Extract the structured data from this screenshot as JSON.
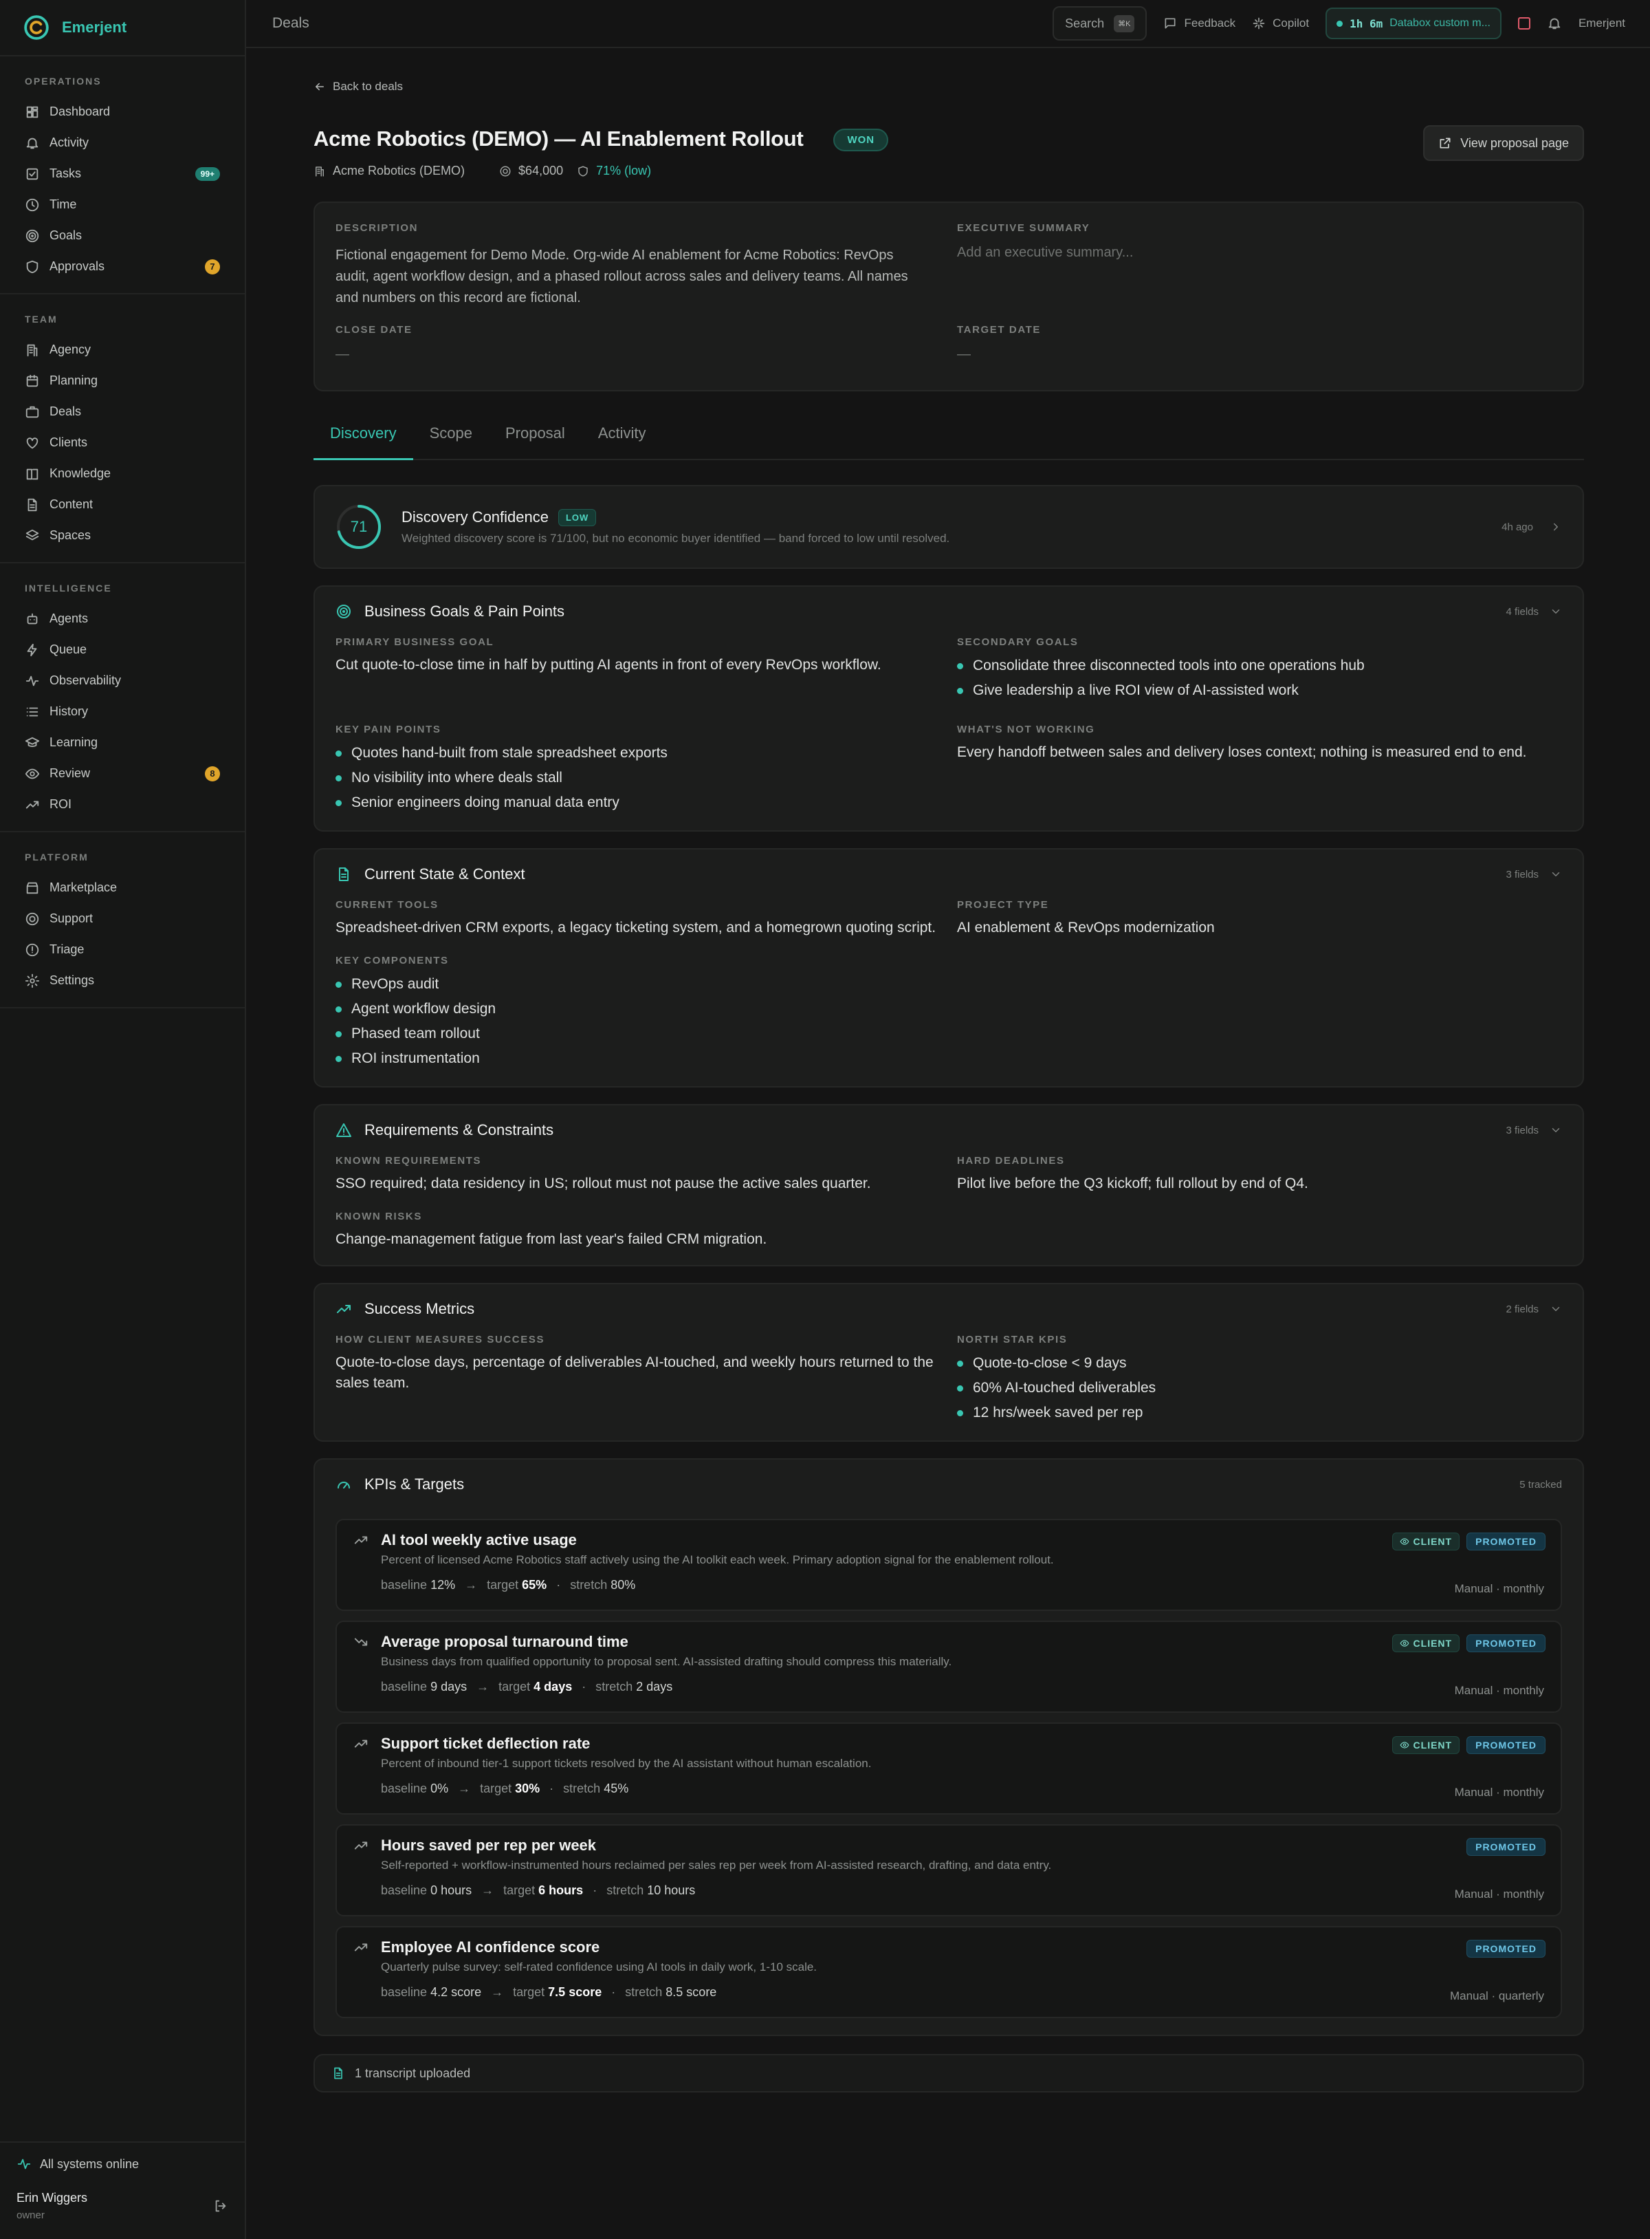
{
  "app": {
    "brand": "Emerjent"
  },
  "sidebar": {
    "sections": [
      {
        "title": "OPERATIONS",
        "items": [
          {
            "label": "Dashboard",
            "icon": "dashboard-icon"
          },
          {
            "label": "Activity",
            "icon": "bell-icon"
          },
          {
            "label": "Tasks",
            "icon": "checkbox-icon",
            "badge": "99+"
          },
          {
            "label": "Time",
            "icon": "clock-icon"
          },
          {
            "label": "Goals",
            "icon": "target-icon"
          },
          {
            "label": "Approvals",
            "icon": "shield-icon",
            "badge": "7"
          }
        ]
      },
      {
        "title": "TEAM",
        "items": [
          {
            "label": "Agency",
            "icon": "building-icon"
          },
          {
            "label": "Planning",
            "icon": "calendar-icon"
          },
          {
            "label": "Deals",
            "icon": "briefcase-icon"
          },
          {
            "label": "Clients",
            "icon": "heart-icon"
          },
          {
            "label": "Knowledge",
            "icon": "book-icon"
          },
          {
            "label": "Content",
            "icon": "document-icon"
          },
          {
            "label": "Spaces",
            "icon": "layers-icon"
          }
        ]
      },
      {
        "title": "INTELLIGENCE",
        "items": [
          {
            "label": "Agents",
            "icon": "bot-icon"
          },
          {
            "label": "Queue",
            "icon": "lightning-icon"
          },
          {
            "label": "Observability",
            "icon": "pulse-icon"
          },
          {
            "label": "History",
            "icon": "list-icon"
          },
          {
            "label": "Learning",
            "icon": "graduation-cap-icon"
          },
          {
            "label": "Review",
            "icon": "eye-icon",
            "badge": "8"
          },
          {
            "label": "ROI",
            "icon": "trending-up-icon"
          }
        ]
      },
      {
        "title": "PLATFORM",
        "items": [
          {
            "label": "Marketplace",
            "icon": "store-icon"
          },
          {
            "label": "Support",
            "icon": "lifebuoy-icon"
          },
          {
            "label": "Triage",
            "icon": "alert-circle-icon"
          },
          {
            "label": "Settings",
            "icon": "gear-icon"
          }
        ]
      }
    ],
    "status": "All systems online",
    "user": {
      "name": "Erin Wiggers",
      "role": "owner"
    }
  },
  "topbar": {
    "breadcrumb": "Deals",
    "search_label": "Search",
    "search_kbd": "⌘K",
    "feedback": "Feedback",
    "copilot": "Copilot",
    "timer_time": "1h 6m",
    "timer_project": "Databox custom m...",
    "workspace": "Emerjent"
  },
  "deal": {
    "back": "Back to deals",
    "title": "Acme Robotics (DEMO) — AI Enablement Rollout",
    "status": "WON",
    "view_proposal": "View proposal page",
    "company": "Acme Robotics (DEMO)",
    "value": "$64,000",
    "confidence": "71% (low)",
    "description_label": "DESCRIPTION",
    "description": "Fictional engagement for Demo Mode. Org-wide AI enablement for Acme Robotics: RevOps audit, agent workflow design, and a phased rollout across sales and delivery teams. All names and numbers on this record are fictional.",
    "exec_label": "EXECUTIVE SUMMARY",
    "exec_placeholder": "Add an executive summary...",
    "close_label": "CLOSE DATE",
    "close_value": "—",
    "target_label": "TARGET DATE",
    "target_value": "—"
  },
  "tabs": [
    "Discovery",
    "Scope",
    "Proposal",
    "Activity"
  ],
  "confidence": {
    "score": "71",
    "score_value": 71,
    "title": "Discovery Confidence",
    "band": "LOW",
    "subtitle": "Weighted discovery score is 71/100, but no economic buyer identified — band forced to low until resolved.",
    "updated": "4h ago"
  },
  "goals": {
    "title": "Business Goals & Pain Points",
    "count": "4 fields",
    "primary_label": "PRIMARY BUSINESS GOAL",
    "primary": "Cut quote-to-close time in half by putting AI agents in front of every RevOps workflow.",
    "secondary_label": "SECONDARY GOALS",
    "secondary": [
      "Consolidate three disconnected tools into one operations hub",
      "Give leadership a live ROI view of AI-assisted work"
    ],
    "pain_label": "KEY PAIN POINTS",
    "pain": [
      "Quotes hand-built from stale spreadsheet exports",
      "No visibility into where deals stall",
      "Senior engineers doing manual data entry"
    ],
    "notworking_label": "WHAT'S NOT WORKING",
    "notworking": "Every handoff between sales and delivery loses context; nothing is measured end to end."
  },
  "state": {
    "title": "Current State & Context",
    "count": "3 fields",
    "tools_label": "CURRENT TOOLS",
    "tools": "Spreadsheet-driven CRM exports, a legacy ticketing system, and a homegrown quoting script.",
    "project_label": "PROJECT TYPE",
    "project": "AI enablement & RevOps modernization",
    "components_label": "KEY COMPONENTS",
    "components": [
      "RevOps audit",
      "Agent workflow design",
      "Phased team rollout",
      "ROI instrumentation"
    ]
  },
  "req": {
    "title": "Requirements & Constraints",
    "count": "3 fields",
    "known_label": "KNOWN REQUIREMENTS",
    "known": "SSO required; data residency in US; rollout must not pause the active sales quarter.",
    "deadline_label": "HARD DEADLINES",
    "deadline": "Pilot live before the Q3 kickoff; full rollout by end of Q4.",
    "risks_label": "KNOWN RISKS",
    "risks": "Change-management fatigue from last year's failed CRM migration."
  },
  "metrics": {
    "title": "Success Metrics",
    "count": "2 fields",
    "how_label": "HOW CLIENT MEASURES SUCCESS",
    "how": "Quote-to-close days, percentage of deliverables AI-touched, and weekly hours returned to the sales team.",
    "kpis_label": "NORTH STAR KPIS",
    "kpis": [
      "Quote-to-close < 9 days",
      "60% AI-touched deliverables",
      "12 hrs/week saved per rep"
    ]
  },
  "kpis": {
    "title": "KPIs & Targets",
    "count": "5 tracked",
    "baseline_label": "baseline",
    "target_label": "target",
    "stretch_label": "stretch",
    "client_tag": "CLIENT",
    "promoted_tag": "PROMOTED",
    "items": [
      {
        "name": "AI tool weekly active usage",
        "desc": "Percent of licensed Acme Robotics staff actively using the AI toolkit each week. Primary adoption signal for the enablement rollout.",
        "baseline": "12%",
        "target": "65%",
        "stretch": "80%",
        "source": "Manual · monthly",
        "client": true,
        "trend": "up"
      },
      {
        "name": "Average proposal turnaround time",
        "desc": "Business days from qualified opportunity to proposal sent. AI-assisted drafting should compress this materially.",
        "baseline": "9 days",
        "target": "4 days",
        "stretch": "2 days",
        "source": "Manual · monthly",
        "client": true,
        "trend": "down"
      },
      {
        "name": "Support ticket deflection rate",
        "desc": "Percent of inbound tier-1 support tickets resolved by the AI assistant without human escalation.",
        "baseline": "0%",
        "target": "30%",
        "stretch": "45%",
        "source": "Manual · monthly",
        "client": true,
        "trend": "up"
      },
      {
        "name": "Hours saved per rep per week",
        "desc": "Self-reported + workflow-instrumented hours reclaimed per sales rep per week from AI-assisted research, drafting, and data entry.",
        "baseline": "0 hours",
        "target": "6 hours",
        "stretch": "10 hours",
        "source": "Manual · monthly",
        "client": false,
        "trend": "up"
      },
      {
        "name": "Employee AI confidence score",
        "desc": "Quarterly pulse survey: self-rated confidence using AI tools in daily work, 1-10 scale.",
        "baseline": "4.2 score",
        "target": "7.5 score",
        "stretch": "8.5 score",
        "source": "Manual · quarterly",
        "client": false,
        "trend": "up"
      }
    ]
  },
  "transcript": "1 transcript uploaded",
  "colors": {
    "accent": "#39c6b2",
    "background": "#141414",
    "card": "#1c1d1c",
    "warning": "#e0a52a"
  }
}
